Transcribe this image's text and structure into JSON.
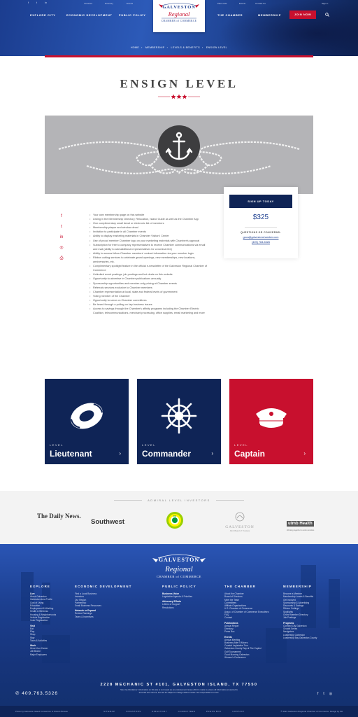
{
  "topbar": {
    "social_icons": [
      "facebook-icon",
      "twitter-icon",
      "linkedin-icon"
    ],
    "links": [
      "Investors",
      "Directory",
      "Events",
      "Place Ads",
      "Events",
      "Contact Us",
      "Sign In"
    ]
  },
  "nav": {
    "explore": "EXPLORE CITY",
    "economic": "ECONOMIC DEVELOPMENT",
    "policy": "PUBLIC POLICY",
    "chamber": "THE CHAMBER",
    "membership": "MEMBERSHIP",
    "join": "JOIN NOW"
  },
  "logo": {
    "line1": "GALVESTON",
    "line2": "Regional",
    "line3": "CHAMBER of COMMERCE"
  },
  "breadcrumb": [
    "HOME",
    "MEMBERSHIP",
    "LEVELS & BENEFITS",
    "ENSIGN LEVEL"
  ],
  "page": {
    "title": "ENSIGN LEVEL"
  },
  "signup": {
    "button": "SIGN UP TODAY",
    "price": "$325",
    "questions": "QUESTIONS OR CONCERNS:",
    "email": "gcca@galvestonchamber.com",
    "phone": "(409) 763-5326"
  },
  "benefits": [
    "Your own membership page on this website",
    "Listing in the Membership Directory, Relocation, Island Guide as well as the Chamber App",
    "One complimentary small decal or electronic list of members",
    "Membership plaque and window decal",
    "Invitation to participate in all Chamber events",
    "Ability to display marketing materials in Chamber Visitors' Center",
    "Use of proud member Chamber logo on your marketing materials with Chamber's approval",
    "Subscription for free to company representatives to receive Chamber communications via email and mail (ability to add additional representatives for a nominal fee)",
    "Ability to access fellow Chamber members' contact information via your member login",
    "Ribbon cutting services to celebrate grand openings, new memberships, new locations, anniversaries, etc.",
    "Complimentary spotlight feature in the official e-newsletter of the Galveston Regional Chamber of Commerce",
    "Unlimited event postings, job postings and hot deals on this website",
    "Opportunity to advertise in Chamber publications annually",
    "Sponsorship opportunities and member-only pricing at Chamber events",
    "Referrals services exclusive to Chamber members",
    "Chamber representation at local, state and federal levels of government",
    "Voting member of the Chamber",
    "Opportunity to serve on Chamber committees",
    "Be heard through a polling on key business issues",
    "Access to savings through the Chamber's affinity programs including the Chamber Electric Coalition, telecommunications, merchant processing, office supplies, email marketing and more"
  ],
  "levels": [
    {
      "label": "LEVEL",
      "name": "Lieutenant",
      "color": "#0f2456",
      "icon": "life-ring-icon"
    },
    {
      "label": "LEVEL",
      "name": "Commander",
      "color": "#0f2456",
      "icon": "ship-wheel-icon"
    },
    {
      "label": "LEVEL",
      "name": "Captain",
      "color": "#c8102e",
      "icon": "captain-hat-icon"
    }
  ],
  "investors": {
    "title": "ADMIRAL LEVEL INVESTORS",
    "sponsors": [
      "The Daily News.",
      "Southwest",
      "bp",
      "GALVESTON",
      "Park Board of Trustees",
      "utmb Health",
      "Working together to work wonders"
    ]
  },
  "footer": {
    "columns": [
      {
        "title": "EXPLORE",
        "groups": [
          {
            "heading": "Live",
            "items": [
              "About Galveston",
              "Galveston Area Profile",
              "Cost of Living",
              "Education",
              "Employment & Working",
              "Health & Wellness",
              "Housing & Neighborhoods",
              "Vehicle Registration",
              "Voter Registration"
            ]
          },
          {
            "heading": "Visit",
            "items": [
              "Eat",
              "Play",
              "Shop",
              "Stay",
              "Tours & Activities"
            ]
          },
          {
            "heading": "Work",
            "items": [
              "Grow Your Career",
              "Job Board",
              "Major Employers"
            ]
          }
        ]
      },
      {
        "title": "ECONOMIC DEVELOPMENT",
        "groups": [
          {
            "heading": "",
            "items": [
              "Find a Local Business",
              "Investors",
              "Our Region",
              "Partnership",
              "Small Business Resources"
            ]
          },
          {
            "heading": "Network or Expand",
            "items": [
              "Review Rankings",
              "Taxes & Incentives"
            ]
          }
        ]
      },
      {
        "title": "PUBLIC POLICY",
        "groups": [
          {
            "heading": "Business Voice",
            "items": [
              "Legislative Agenda & Priorities"
            ]
          },
          {
            "heading": "Advocacy Efforts",
            "items": [
              "Letters of Support",
              "Resolutions"
            ]
          }
        ]
      },
      {
        "title": "THE CHAMBER",
        "groups": [
          {
            "heading": "",
            "items": [
              "About the Chamber",
              "Board of Directors",
              "Meet the Team",
              "Committees",
              "Affiliate Organizations",
              "U.S. Chamber of Commerce",
              "Assoc. of Chamber of Commerce Executives",
              "FAQ",
              "Contact"
            ]
          },
          {
            "heading": "Publications",
            "items": [
              "Annual Report",
              "Directory",
              "Press Box"
            ]
          },
          {
            "heading": "Events",
            "items": [
              "Annual Meeting",
              "Business After 5 Mixers",
              "Coastal Legislative Tour",
              "Galveston County Day at The Capitol",
              "Golf Tournament",
              "Good Morning Galveston",
              "Women's Conference"
            ]
          }
        ]
      },
      {
        "title": "MEMBERSHIP",
        "groups": [
          {
            "heading": "",
            "items": [
              "Become a Member",
              "Membership Levels & Benefits",
              "Get Involved",
              "Sponsorship & Advertising",
              "Discounts & Savings",
              "Ribbon Cuttings",
              "Spotlights",
              "Online Member Directory",
              "Job Postings"
            ]
          },
          {
            "heading": "Programs",
            "items": [
              "Connect City Galveston",
              "Growth Series",
              "Navigators",
              "Leadership Galveston",
              "Leadership Bay Galveston County"
            ]
          }
        ]
      }
    ],
    "address": "2228 MECHANIC ST #101, GALVESTON ISLAND, TX 77550",
    "phone": "409.763.5326",
    "disclaimer": "Site Use Disclaimer: Information on this site is not meant as an endorsement. Every effort is made to ensure all information presented is accurate and current, but can be subject to change without notice. Not responsible for errors.",
    "social_icons": [
      "facebook-icon",
      "twitter-icon",
      "instagram-icon"
    ],
    "bottom_left": "Photo by Galveston Island Convention & Visitors Bureau",
    "bottom_links": [
      "SITEMAP",
      "INVESTORS",
      "DIRECTORY",
      "COMMITTEES",
      "PRESS BOX",
      "CONTACT"
    ],
    "bottom_right": "© 2024 Galveston Regional Chamber of Commerce. Design by ZH"
  },
  "colors": {
    "navy": "#0f2456",
    "blue": "#1b3d8f",
    "red": "#c8102e"
  }
}
